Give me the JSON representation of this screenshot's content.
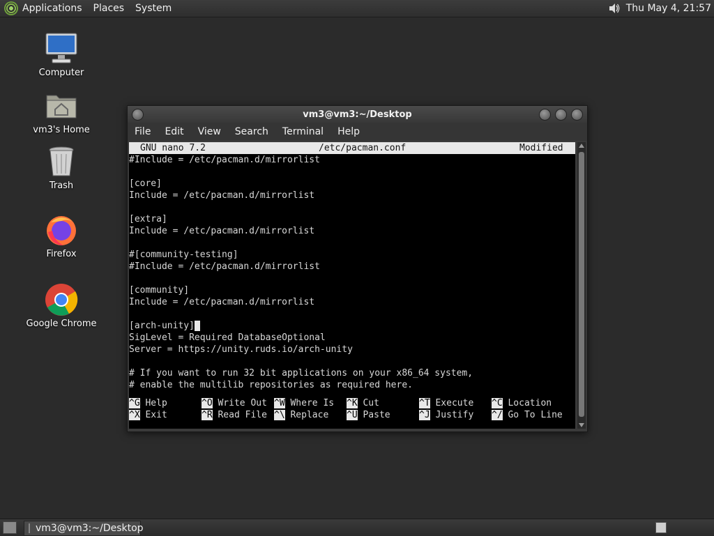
{
  "top_panel": {
    "menus": [
      "Applications",
      "Places",
      "System"
    ],
    "clock": "Thu May  4, 21:57"
  },
  "desktop_icons": [
    {
      "label": "Computer"
    },
    {
      "label": "vm3's Home"
    },
    {
      "label": "Trash"
    },
    {
      "label": "Firefox"
    },
    {
      "label": "Google Chrome"
    }
  ],
  "window": {
    "title": "vm3@vm3:~/Desktop",
    "menu": [
      "File",
      "Edit",
      "View",
      "Search",
      "Terminal",
      "Help"
    ]
  },
  "nano": {
    "version": "GNU nano 7.2",
    "filename": "/etc/pacman.conf",
    "status": "Modified",
    "lines": [
      "#Include = /etc/pacman.d/mirrorlist",
      "",
      "[core]",
      "Include = /etc/pacman.d/mirrorlist",
      "",
      "[extra]",
      "Include = /etc/pacman.d/mirrorlist",
      "",
      "#[community-testing]",
      "#Include = /etc/pacman.d/mirrorlist",
      "",
      "[community]",
      "Include = /etc/pacman.d/mirrorlist",
      "",
      "[arch-unity]",
      "SigLevel = Required DatabaseOptional",
      "Server = https://unity.ruds.io/arch-unity",
      "",
      "# If you want to run 32 bit applications on your x86_64 system,",
      "# enable the multilib repositories as required here."
    ],
    "shortcuts_row1": [
      {
        "key": "^G",
        "label": "Help"
      },
      {
        "key": "^O",
        "label": "Write Out"
      },
      {
        "key": "^W",
        "label": "Where Is"
      },
      {
        "key": "^K",
        "label": "Cut"
      },
      {
        "key": "^T",
        "label": "Execute"
      },
      {
        "key": "^C",
        "label": "Location"
      }
    ],
    "shortcuts_row2": [
      {
        "key": "^X",
        "label": "Exit"
      },
      {
        "key": "^R",
        "label": "Read File"
      },
      {
        "key": "^\\",
        "label": "Replace"
      },
      {
        "key": "^U",
        "label": "Paste"
      },
      {
        "key": "^J",
        "label": "Justify"
      },
      {
        "key": "^/",
        "label": "Go To Line"
      }
    ]
  },
  "taskbar": {
    "task_label": "vm3@vm3:~/Desktop"
  }
}
